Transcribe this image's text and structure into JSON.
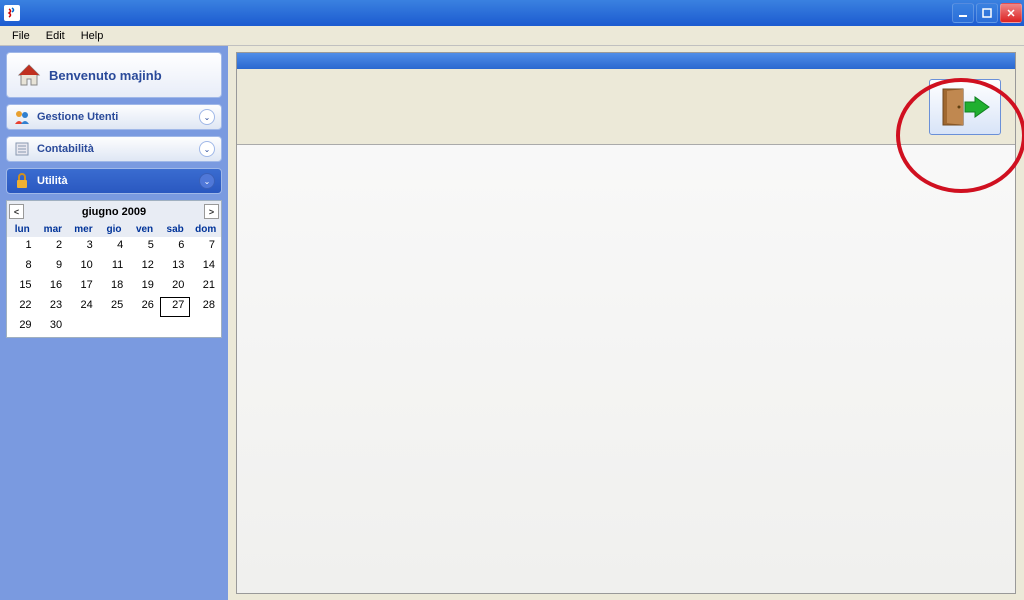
{
  "window": {
    "title": ""
  },
  "menubar": {
    "file": "File",
    "edit": "Edit",
    "help": "Help"
  },
  "welcome": {
    "text": "Benvenuto majinb"
  },
  "sections": {
    "users": "Gestione Utenti",
    "accounting": "Contabilità",
    "utility": "Utilità"
  },
  "calendar": {
    "title": "giugno 2009",
    "days": [
      "lun",
      "mar",
      "mer",
      "gio",
      "ven",
      "sab",
      "dom"
    ],
    "today": 27,
    "weeks": [
      [
        1,
        2,
        3,
        4,
        5,
        6,
        7
      ],
      [
        8,
        9,
        10,
        11,
        12,
        13,
        14
      ],
      [
        15,
        16,
        17,
        18,
        19,
        20,
        21
      ],
      [
        22,
        23,
        24,
        25,
        26,
        27,
        28
      ],
      [
        29,
        30,
        null,
        null,
        null,
        null,
        null
      ]
    ]
  }
}
